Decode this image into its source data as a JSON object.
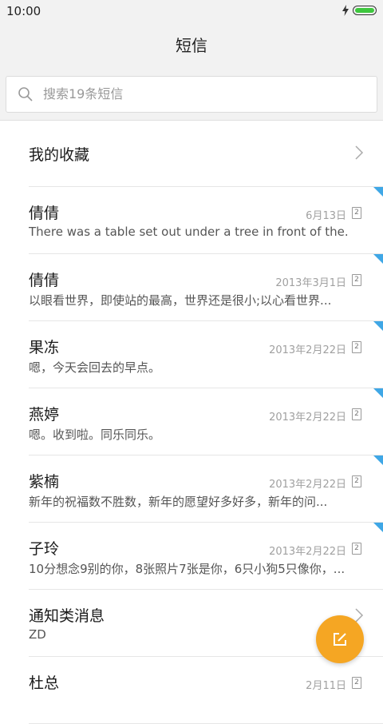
{
  "status_bar": {
    "time": "10:00"
  },
  "header": {
    "title": "短信"
  },
  "search": {
    "placeholder": "搜索19条短信"
  },
  "favorites": {
    "label": "我的收藏"
  },
  "messages": [
    {
      "name": "倩倩",
      "date": "6月13日",
      "sim": "2",
      "preview": "There was a table set out under a tree in front of the...",
      "unread": true
    },
    {
      "name": "倩倩",
      "date": "2013年3月1日",
      "sim": "2",
      "preview": "以眼看世界，即使站的最高，世界还是很小;以心看世界...",
      "unread": true
    },
    {
      "name": "果冻",
      "date": "2013年2月22日",
      "sim": "2",
      "preview": "嗯，今天会回去的早点。",
      "unread": true
    },
    {
      "name": "燕婷",
      "date": "2013年2月22日",
      "sim": "2",
      "preview": "嗯。收到啦。同乐同乐。",
      "unread": true
    },
    {
      "name": "紫楠",
      "date": "2013年2月22日",
      "sim": "2",
      "preview": "新年的祝福数不胜数，新年的愿望好多好多，新年的问...",
      "unread": true
    },
    {
      "name": "子玲",
      "date": "2013年2月22日",
      "sim": "2",
      "preview": "10分想念9别的你，8张照片7张是你，6只小狗5只像你，...",
      "unread": true
    },
    {
      "name": "通知类消息",
      "date": "",
      "sim": "",
      "preview": "ZD",
      "unread": false
    },
    {
      "name": "杜总",
      "date": "2月11日",
      "sim": "2",
      "preview": "",
      "unread": false
    }
  ],
  "colors": {
    "accent": "#f5a623",
    "unread": "#3fa7e6",
    "battery": "#3ec73e"
  },
  "icons": {
    "search": "search-icon",
    "chevron": "chevron-right-icon",
    "compose": "compose-icon",
    "charging": "bolt-icon",
    "battery": "battery-icon"
  }
}
